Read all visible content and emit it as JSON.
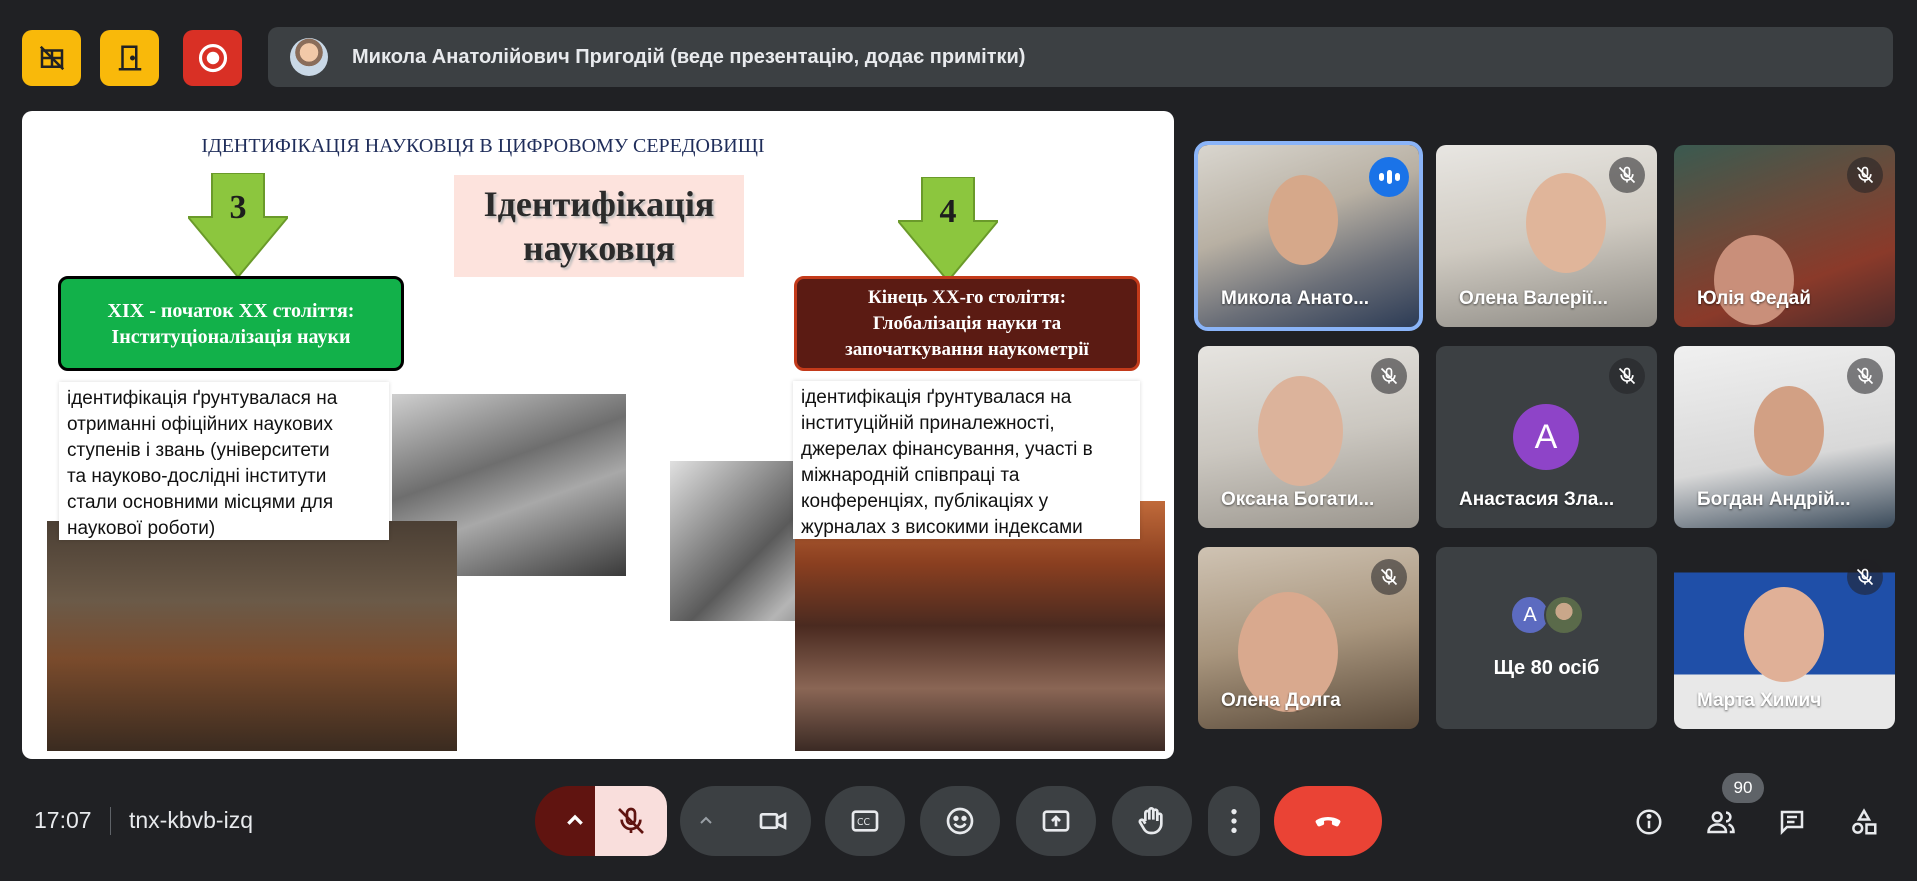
{
  "top_bar": {
    "presenter_text": "Микола Анатолійович Пригодій (веде презентацію, додає примітки)"
  },
  "colors": {
    "yellow": "#f9b90a",
    "red": "#d93025",
    "active_border": "#8ab4f8",
    "end_call": "#ea4335"
  },
  "slide": {
    "heading": "ІДЕНТИФІКАЦІЯ НАУКОВЦЯ В ЦИФРОВОМУ СЕРЕДОВИЩІ",
    "center_line1": "Ідентифікація",
    "center_line2": "науковця",
    "arrow_left": "3",
    "arrow_right": "4",
    "green_line1": "XIX - початок XX століття:",
    "green_line2": "Інституціоналізація науки",
    "brown_line1": "Кінець XX-го століття:",
    "brown_line2": "Глобалізація науки та",
    "brown_line3": "започаткування наукометрії",
    "left_desc": [
      "ідентифікація ґрунтувалася на",
      "отриманні офіційних наукових",
      "ступенів і звань (університети",
      "та науково-дослідні інститути",
      "стали основними місцями для",
      "наукової роботи)"
    ],
    "right_desc": [
      "ідентифікація ґрунтувалася на",
      "інституційній приналежності,",
      "джерелах фінансування, участі в",
      "міжнародній співпраці та",
      "конференціях, публікаціях у",
      "журналах з високими індексами"
    ]
  },
  "participants": [
    {
      "name": "Микола Анато...",
      "speaking": true
    },
    {
      "name": "Олена Валерії...",
      "muted": true
    },
    {
      "name": "Юлія Федай",
      "muted": true
    },
    {
      "name": "Оксана Богати...",
      "muted": true
    },
    {
      "name": "Анастасия Зла...",
      "muted": true,
      "initial": "A"
    },
    {
      "name": "Богдан Андрій...",
      "muted": true
    },
    {
      "name": "Олена Долга",
      "muted": true
    },
    {
      "name": "Ще 80 осіб",
      "avatar_initial": "A"
    },
    {
      "name": "Марта Химич",
      "muted": true
    }
  ],
  "bottom_bar": {
    "time": "17:07",
    "meeting_code": "tnx-kbvb-izq",
    "people_count": "90",
    "icons": [
      "mic-off-icon",
      "camera-icon",
      "captions-icon",
      "emoji-icon",
      "present-icon",
      "raise-hand-icon",
      "more-icon",
      "end-call-icon",
      "info-icon",
      "people-icon",
      "chat-icon",
      "activities-icon"
    ]
  }
}
